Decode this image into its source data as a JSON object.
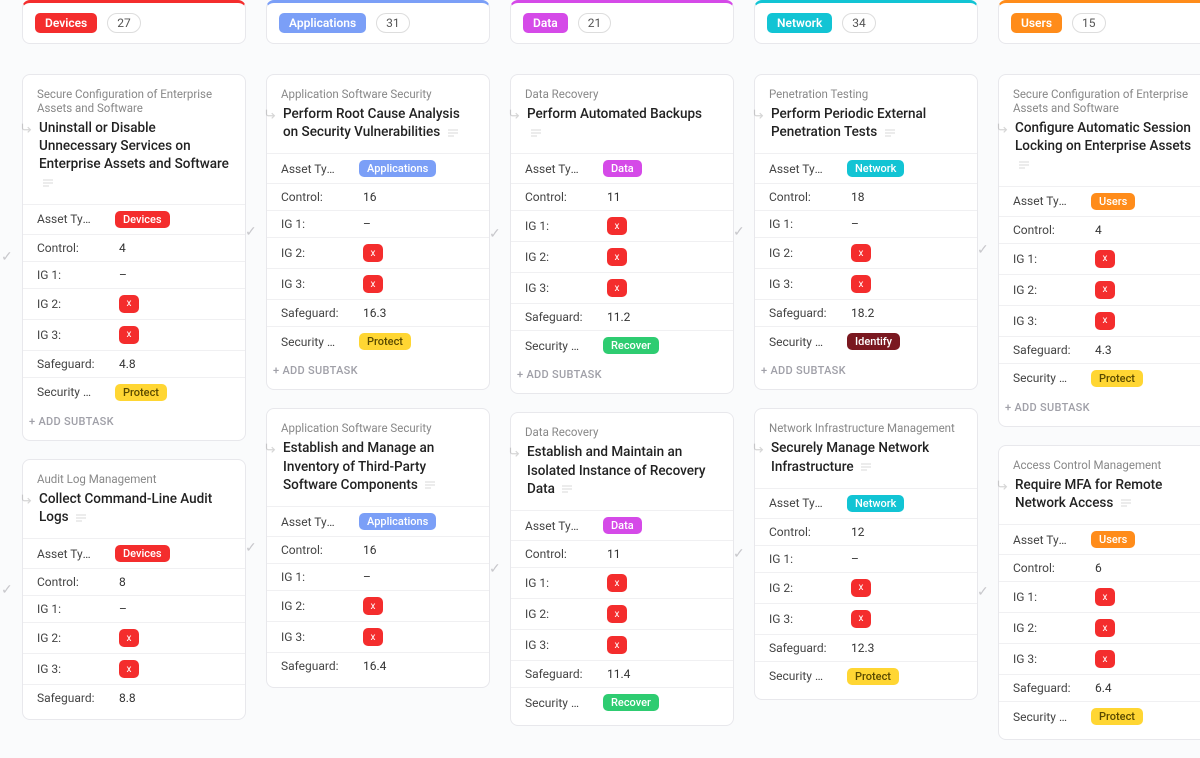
{
  "labels": {
    "asset_type": "Asset Type:",
    "control": "Control:",
    "ig1": "IG 1:",
    "ig2": "IG 2:",
    "ig3": "IG 3:",
    "safeguard": "Safeguard:",
    "security_fn": "Security Fu...",
    "add_subtask": "+ ADD SUBTASK",
    "dash": "–",
    "x": "x"
  },
  "columns": [
    {
      "name": "Devices",
      "count": "27",
      "color": "#f42d2d",
      "badgeClass": "bg-red"
    },
    {
      "name": "Applications",
      "count": "31",
      "color": "#7b9ff7",
      "badgeClass": "bg-medblue"
    },
    {
      "name": "Data",
      "count": "21",
      "color": "#d54ae8",
      "badgeClass": "bg-purple"
    },
    {
      "name": "Network",
      "count": "34",
      "color": "#12c4d4",
      "badgeClass": "bg-cyan"
    },
    {
      "name": "Users",
      "count": "15",
      "color": "#ff8c1a",
      "badgeClass": "bg-orange"
    }
  ],
  "cards": [
    [
      {
        "category": "Secure Configuration of Enterprise Assets and Software",
        "title": "Uninstall or Disable Unnecessary Services on Enterprise Assets and Software",
        "asset": {
          "text": "Devices",
          "cls": "bg-red"
        },
        "control": "4",
        "ig1": "–",
        "ig2": "x",
        "ig3": "x",
        "safeguard": "4.8",
        "fn": {
          "text": "Protect",
          "cls": "bg-yellow"
        },
        "add": true
      },
      {
        "category": "Audit Log Management",
        "title": "Collect Command-Line Audit Logs",
        "asset": {
          "text": "Devices",
          "cls": "bg-red"
        },
        "control": "8",
        "ig1": "–",
        "ig2": "x",
        "ig3": "x",
        "safeguard": "8.8",
        "fn": null,
        "add": false,
        "truncated": true
      }
    ],
    [
      {
        "category": "Application Software Security",
        "title": "Perform Root Cause Analysis on Security Vulnerabilities",
        "asset": {
          "text": "Applications",
          "cls": "bg-medblue"
        },
        "control": "16",
        "ig1": "–",
        "ig2": "x",
        "ig3": "x",
        "safeguard": "16.3",
        "fn": {
          "text": "Protect",
          "cls": "bg-yellow"
        },
        "add": true
      },
      {
        "category": "Application Software Security",
        "title": "Establish and Manage an Inventory of Third-Party Software Components",
        "asset": {
          "text": "Applications",
          "cls": "bg-medblue"
        },
        "control": "16",
        "ig1": "–",
        "ig2": "x",
        "ig3": "x",
        "safeguard": "16.4",
        "fn": null,
        "add": false,
        "truncated": true
      }
    ],
    [
      {
        "category": "Data Recovery",
        "title": "Perform Automated Backups",
        "asset": {
          "text": "Data",
          "cls": "bg-purple"
        },
        "control": "11",
        "ig1": "x",
        "ig2": "x",
        "ig3": "x",
        "safeguard": "11.2",
        "fn": {
          "text": "Recover",
          "cls": "bg-green"
        },
        "add": true
      },
      {
        "category": "Data Recovery",
        "title": "Establish and Maintain an Isolated Instance of Recovery Data",
        "asset": {
          "text": "Data",
          "cls": "bg-purple"
        },
        "control": "11",
        "ig1": "x",
        "ig2": "x",
        "ig3": "x",
        "safeguard": "11.4",
        "fn": {
          "text": "Recover",
          "cls": "bg-green"
        },
        "add": false,
        "truncated": true
      }
    ],
    [
      {
        "category": "Penetration Testing",
        "title": "Perform Periodic External Penetration Tests",
        "asset": {
          "text": "Network",
          "cls": "bg-cyan"
        },
        "control": "18",
        "ig1": "–",
        "ig2": "x",
        "ig3": "x",
        "safeguard": "18.2",
        "fn": {
          "text": "Identify",
          "cls": "bg-darkred"
        },
        "add": true
      },
      {
        "category": "Network Infrastructure Management",
        "title": "Securely Manage Network Infrastructure",
        "asset": {
          "text": "Network",
          "cls": "bg-cyan"
        },
        "control": "12",
        "ig1": "–",
        "ig2": "x",
        "ig3": "x",
        "safeguard": "12.3",
        "fn": {
          "text": "Protect",
          "cls": "bg-yellow"
        },
        "add": false,
        "truncated": true
      }
    ],
    [
      {
        "category": "Secure Configuration of Enterprise Assets and Software",
        "title": "Configure Automatic Session Locking on Enterprise Assets",
        "asset": {
          "text": "Users",
          "cls": "bg-orange"
        },
        "control": "4",
        "ig1": "x",
        "ig2": "x",
        "ig3": "x",
        "safeguard": "4.3",
        "fn": {
          "text": "Protect",
          "cls": "bg-yellow"
        },
        "add": true
      },
      {
        "category": "Access Control Management",
        "title": "Require MFA for Remote Network Access",
        "asset": {
          "text": "Users",
          "cls": "bg-orange"
        },
        "control": "6",
        "ig1": "x",
        "ig2": "x",
        "ig3": "x",
        "safeguard": "6.4",
        "fn": {
          "text": "Protect",
          "cls": "bg-yellow"
        },
        "add": false,
        "truncated": true
      }
    ]
  ]
}
